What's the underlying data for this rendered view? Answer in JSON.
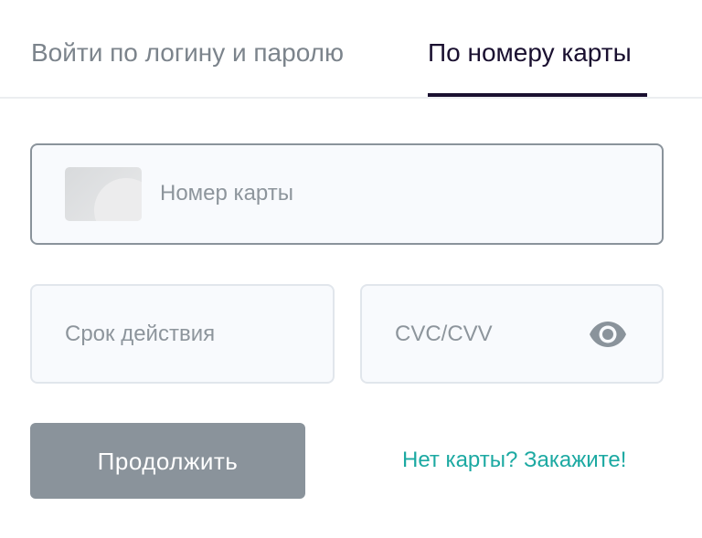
{
  "tabs": {
    "login": "Войти по логину и паролю",
    "card": "По номеру карты",
    "active": "card"
  },
  "form": {
    "card_number_placeholder": "Номер карты",
    "expiry_placeholder": "Срок действия",
    "cvc_placeholder": "CVC/CVV",
    "cvc_toggle_icon": "eye-icon"
  },
  "actions": {
    "continue_label": "Продолжить",
    "order_link": "Нет карты? Закажите!"
  },
  "colors": {
    "active_tab": "#1a1030",
    "inactive_tab": "#7c848c",
    "button_bg": "#8a939b",
    "link": "#1ca9a2"
  }
}
